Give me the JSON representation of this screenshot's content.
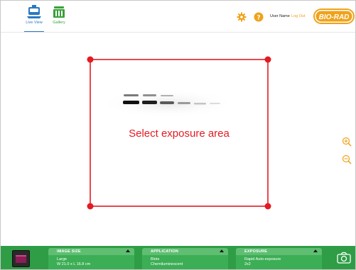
{
  "header": {
    "nav": [
      {
        "label": "Live View",
        "icon": "live-view-icon",
        "active": true
      },
      {
        "label": "Gallery",
        "icon": "gallery-icon",
        "active": false
      }
    ],
    "settings_icon": "gear-icon",
    "help_icon": "question-icon",
    "user_name": "User Name",
    "logout": "Log Out",
    "brand": "BIO-RAD"
  },
  "viewport": {
    "selection_label": "Select exposure area",
    "zoom_in_icon": "zoom-in-icon",
    "zoom_out_icon": "zoom-out-icon"
  },
  "bottom_bar": {
    "panels": [
      {
        "title": "IMAGE SIZE",
        "line1": "Large",
        "line2": "W 21.0 x L 16.8 cm"
      },
      {
        "title": "APPLICATION",
        "line1": "Blots",
        "line2": "Chemiluminescent"
      },
      {
        "title": "EXPOSURE",
        "line1": "Rapid Auto-exposure",
        "line2": "2x2"
      }
    ],
    "capture_icon": "camera-icon"
  },
  "colors": {
    "selection_red": "#e31b23",
    "brand_orange": "#f0a21a",
    "live_view_blue": "#2b78c2",
    "gallery_green": "#3aa03a",
    "bottom_bar_green": "#2f9d46"
  }
}
